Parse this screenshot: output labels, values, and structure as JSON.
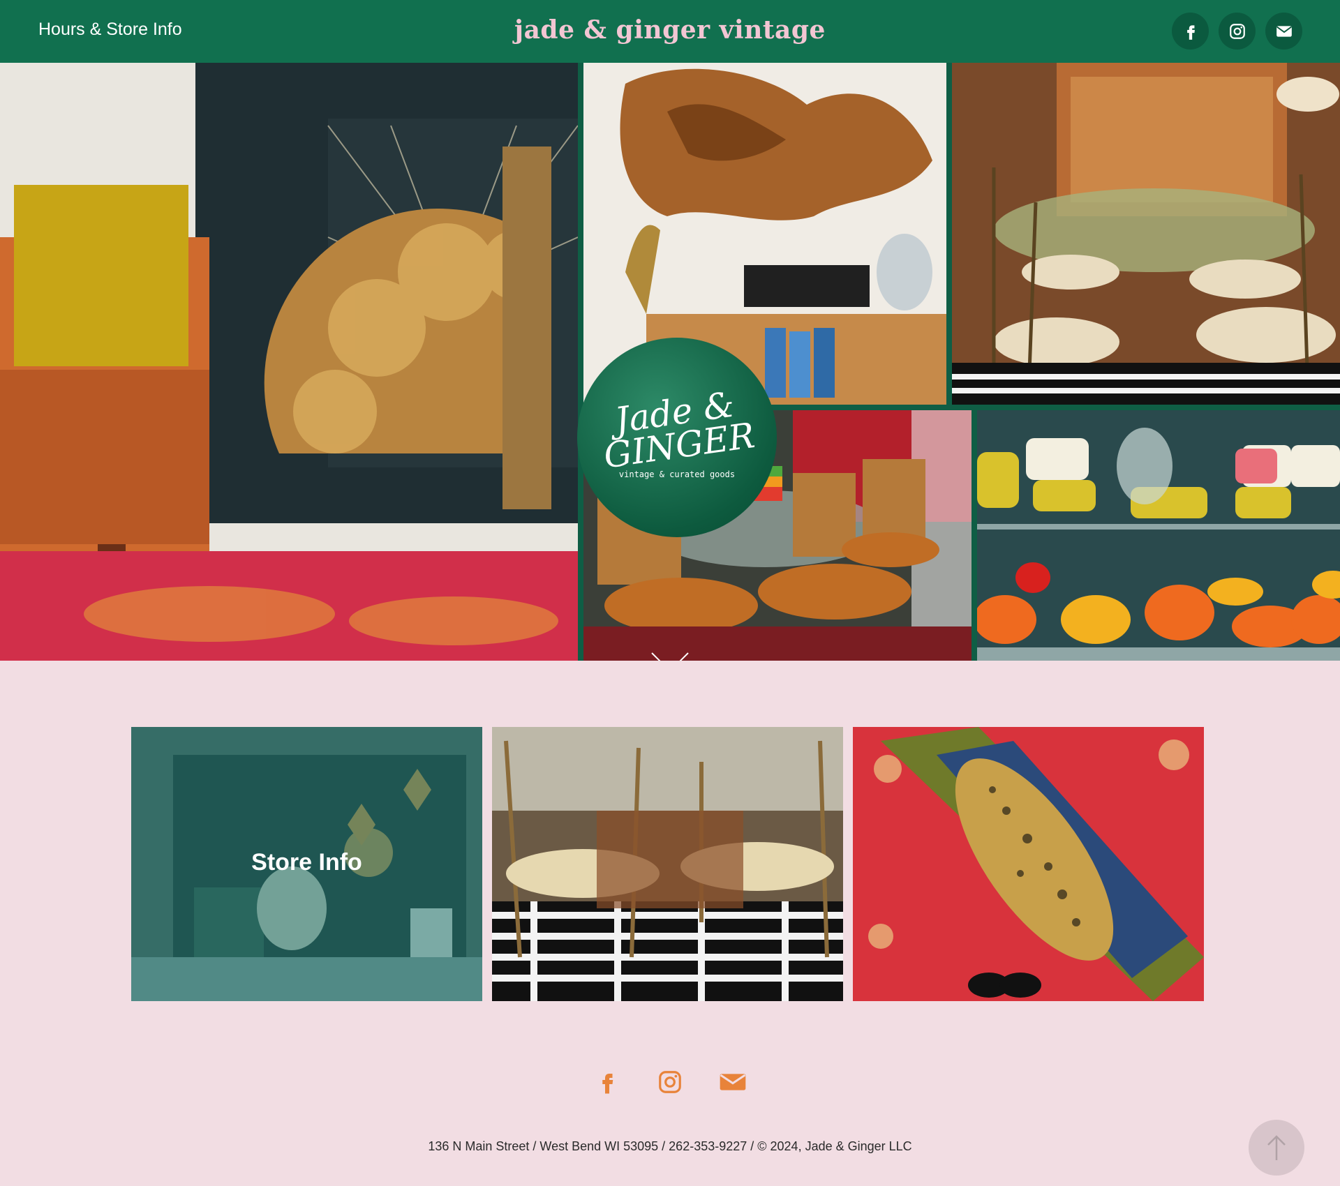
{
  "header": {
    "nav_link": "Hours & Store Info",
    "site_title": "jade & ginger vintage",
    "social": [
      "facebook-icon",
      "instagram-icon",
      "email-icon"
    ]
  },
  "hero": {
    "logo_script": "Jade & GINGER",
    "logo_tagline": "vintage & curated goods"
  },
  "gallery": {
    "tiles": [
      {
        "label": "Store Info"
      },
      {
        "label": ""
      },
      {
        "label": ""
      }
    ]
  },
  "footer": {
    "social": [
      "facebook-icon",
      "instagram-icon",
      "email-icon"
    ],
    "text": "136 N Main Street / West Bend WI 53095 / 262-353-9227 / © 2024, Jade & Ginger LLC"
  },
  "colors": {
    "header_bg": "#11704f",
    "title_pink": "#f2c6d3",
    "page_bg": "#f2dde3",
    "footer_icon": "#e8833a"
  }
}
